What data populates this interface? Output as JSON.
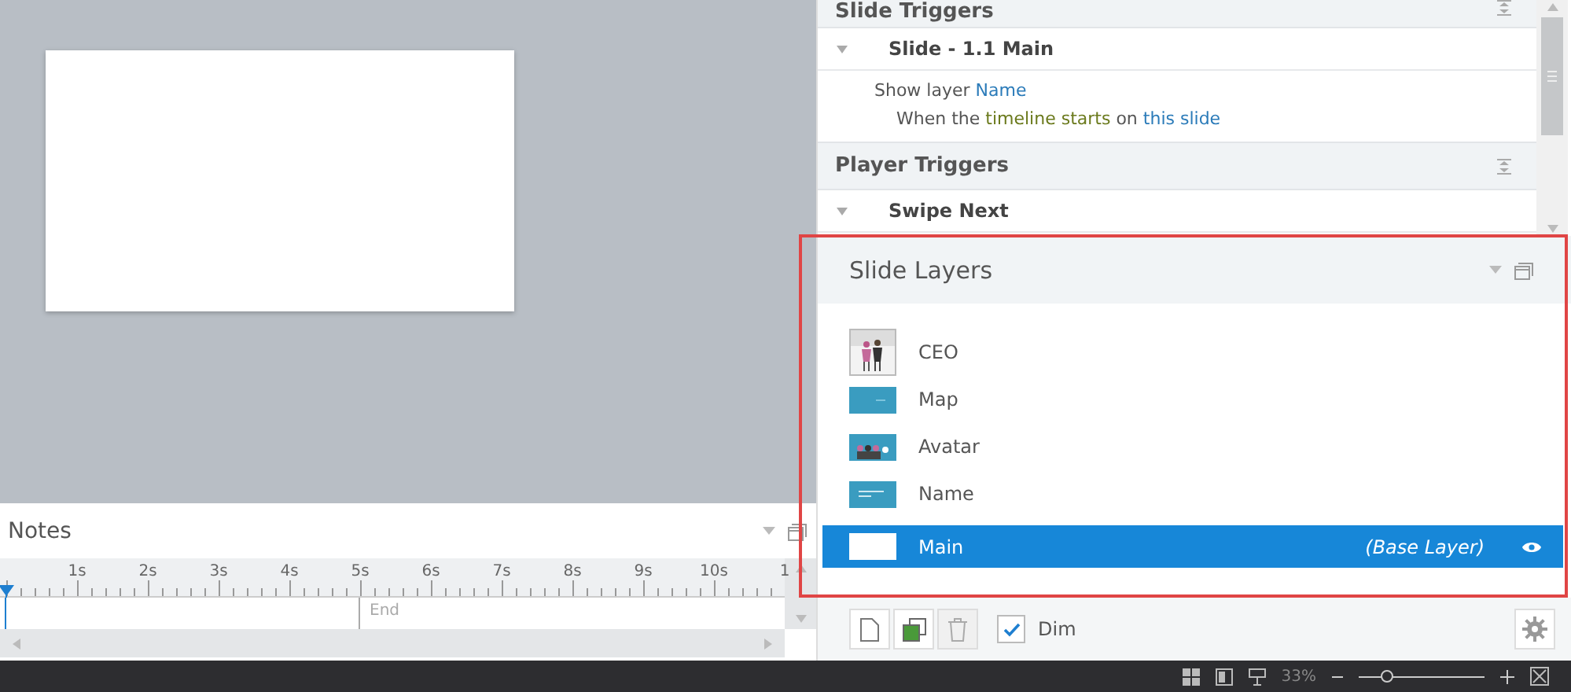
{
  "trigger_sections": [
    {
      "title": "Slide Triggers",
      "items": [
        {
          "name": "Slide - 1.1 Main",
          "expanded": true,
          "details": [
            [
              {
                "kind": "plain",
                "text": "Show layer"
              },
              {
                "kind": "target",
                "text": "Name"
              }
            ],
            [
              {
                "kind": "plain",
                "text": "When the"
              },
              {
                "kind": "event",
                "text": "timeline starts"
              },
              {
                "kind": "plain",
                "text": "on"
              },
              {
                "kind": "target",
                "text": "this slide"
              }
            ]
          ]
        }
      ]
    },
    {
      "title": "Player Triggers",
      "items": [
        {
          "name": "Swipe Next",
          "expanded": true
        }
      ]
    }
  ],
  "slide_layers": {
    "title": "Slide Layers",
    "layers": [
      {
        "name": "CEO",
        "selected": false
      },
      {
        "name": "Map",
        "selected": false
      },
      {
        "name": "Avatar",
        "selected": false
      },
      {
        "name": "Name",
        "selected": false
      },
      {
        "name": "Main",
        "note": "(Base Layer)",
        "selected": true,
        "visible": true
      }
    ]
  },
  "layer_toolbar": {
    "dim": {
      "label": "Dim",
      "checked": true
    }
  },
  "notes": {
    "title": "Notes",
    "ruler": [
      "1s",
      "2s",
      "3s",
      "4s",
      "5s",
      "6s",
      "7s",
      "8s",
      "9s",
      "10s",
      "1"
    ],
    "end_label": "End"
  },
  "status_bar": {
    "zoom": "33%",
    "zoom_slider": {
      "level": 0.22
    }
  }
}
